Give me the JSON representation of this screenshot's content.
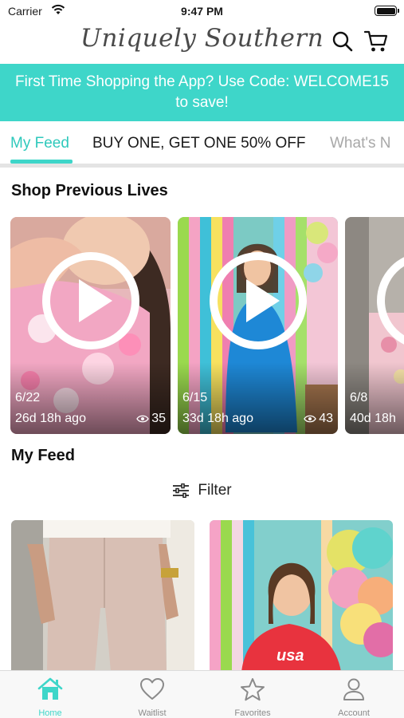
{
  "status_bar": {
    "carrier": "Carrier",
    "time": "9:47 PM"
  },
  "header": {
    "brand": "Uniquely Southern"
  },
  "promo": {
    "line1": "First Time Shopping the App? Use Code: WELCOME15",
    "line2": "to save!"
  },
  "tabs": [
    {
      "label": "My Feed",
      "active": true
    },
    {
      "label": "BUY ONE, GET ONE 50% OFF",
      "active": false
    },
    {
      "label": "What's N",
      "active": false
    }
  ],
  "lives": {
    "title": "Shop Previous Lives",
    "items": [
      {
        "date": "6/22",
        "ago": "26d 18h ago",
        "views": "35"
      },
      {
        "date": "6/15",
        "ago": "33d 18h ago",
        "views": "43"
      },
      {
        "date": "6/8",
        "ago": "40d 18h",
        "views": ""
      }
    ]
  },
  "feed": {
    "title": "My Feed",
    "filter_label": "Filter"
  },
  "bottom_nav": [
    {
      "label": "Home",
      "icon": "home-icon",
      "active": true
    },
    {
      "label": "Waitlist",
      "icon": "heart-icon",
      "active": false
    },
    {
      "label": "Favorites",
      "icon": "star-icon",
      "active": false
    },
    {
      "label": "Account",
      "icon": "person-icon",
      "active": false
    }
  ],
  "colors": {
    "accent": "#3ed6c9",
    "accent_text": "#2fc9bc",
    "muted": "#8a8a8a"
  }
}
